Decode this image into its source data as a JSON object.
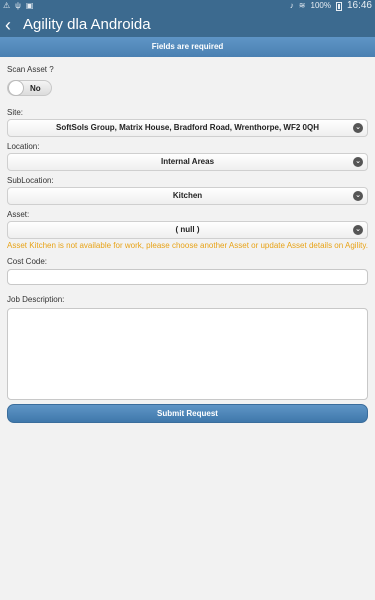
{
  "status_bar": {
    "battery": "100%",
    "time": "16:46"
  },
  "app_bar": {
    "title": "Agility dla Androida"
  },
  "banner": {
    "text": "Fields are required"
  },
  "form": {
    "scan_asset": {
      "label": "Scan Asset ?",
      "toggle_value": "No"
    },
    "site": {
      "label": "Site:",
      "value": "SoftSols Group, Matrix House, Bradford Road, Wrenthorpe, WF2 0QH"
    },
    "location": {
      "label": "Location:",
      "value": "Internal Areas"
    },
    "sublocation": {
      "label": "SubLocation:",
      "value": "Kitchen"
    },
    "asset": {
      "label": "Asset:",
      "value": "( null )"
    },
    "warning": "Asset Kitchen is not available for work, please choose another Asset or update Asset details on Agility.",
    "cost_code": {
      "label": "Cost Code:",
      "value": ""
    },
    "job_description": {
      "label": "Job Description:",
      "value": ""
    },
    "submit_label": "Submit Request"
  }
}
